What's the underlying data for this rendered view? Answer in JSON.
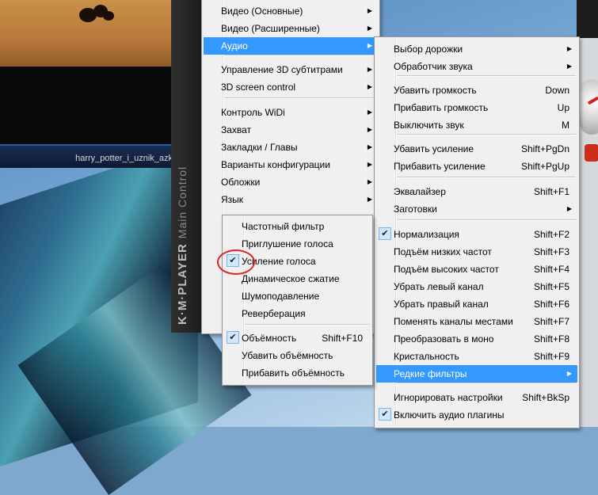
{
  "player": {
    "filename": "harry_potter_i_uznik_azk",
    "brand": "K·M·PLAYER",
    "brand_sub": "Main Control"
  },
  "main_menu": {
    "items": [
      {
        "label": "Видео (Основные)",
        "arrow": "▶"
      },
      {
        "label": "Видео (Расширенные)",
        "arrow": "▶"
      },
      {
        "label": "Аудио",
        "arrow": "▶",
        "highlight": true
      },
      {
        "label": "Управление 3D субтитрами",
        "arrow": "▶"
      },
      {
        "label": "3D screen control",
        "arrow": "▶"
      },
      {
        "label": "Контроль WiDi",
        "arrow": "▶"
      },
      {
        "label": "Захват",
        "arrow": "▶"
      },
      {
        "label": "Закладки / Главы",
        "arrow": "▶"
      },
      {
        "label": "Варианты конфигурации",
        "arrow": "▶"
      },
      {
        "label": "Обложки",
        "arrow": "▶"
      },
      {
        "label": "Язык",
        "arrow": "▶"
      }
    ]
  },
  "audio_menu": {
    "items": [
      {
        "label": "Выбор дорожки",
        "arrow": "▶"
      },
      {
        "label": "Обработчик звука",
        "arrow": "▶"
      },
      {
        "label": "Убавить громкость",
        "shortcut": "Down"
      },
      {
        "label": "Прибавить громкость",
        "shortcut": "Up"
      },
      {
        "label": "Выключить звук",
        "shortcut": "M"
      },
      {
        "label": "Убавить усиление",
        "shortcut": "Shift+PgDn"
      },
      {
        "label": "Прибавить усиление",
        "shortcut": "Shift+PgUp"
      },
      {
        "label": "Эквалайзер",
        "shortcut": "Shift+F1"
      },
      {
        "label": "Заготовки",
        "arrow": "▶"
      },
      {
        "label": "Нормализация",
        "shortcut": "Shift+F2",
        "checked": true
      },
      {
        "label": "Подъём низких частот",
        "shortcut": "Shift+F3"
      },
      {
        "label": "Подъём высоких частот",
        "shortcut": "Shift+F4"
      },
      {
        "label": "Убрать левый канал",
        "shortcut": "Shift+F5"
      },
      {
        "label": "Убрать правый канал",
        "shortcut": "Shift+F6"
      },
      {
        "label": "Поменять каналы местами",
        "shortcut": "Shift+F7"
      },
      {
        "label": "Преобразовать в моно",
        "shortcut": "Shift+F8"
      },
      {
        "label": "Кристальность",
        "shortcut": "Shift+F9"
      },
      {
        "label": "Редкие фильтры",
        "arrow": "▶",
        "highlight": true
      },
      {
        "label": "Игнорировать настройки",
        "shortcut": "Shift+BkSp"
      },
      {
        "label": "Включить аудио плагины",
        "checked": true
      }
    ]
  },
  "rare_menu": {
    "items": [
      {
        "label": "Частотный фильтр"
      },
      {
        "label": "Приглушение голоса"
      },
      {
        "label": "Усиление голоса",
        "checked": true
      },
      {
        "label": "Динамическое сжатие"
      },
      {
        "label": "Шумоподавление"
      },
      {
        "label": "Реверберация"
      },
      {
        "label": "Объёмность",
        "shortcut": "Shift+F10",
        "checked": true
      },
      {
        "label": "Убавить объёмность"
      },
      {
        "label": "Прибавить объёмность"
      }
    ]
  },
  "icons": {
    "check": "✔",
    "submenu": "submenu-arrow-icon"
  },
  "colors": {
    "highlight": "#3399ff",
    "menu_bg": "#f0f0f0",
    "annotation": "#e0242b"
  }
}
